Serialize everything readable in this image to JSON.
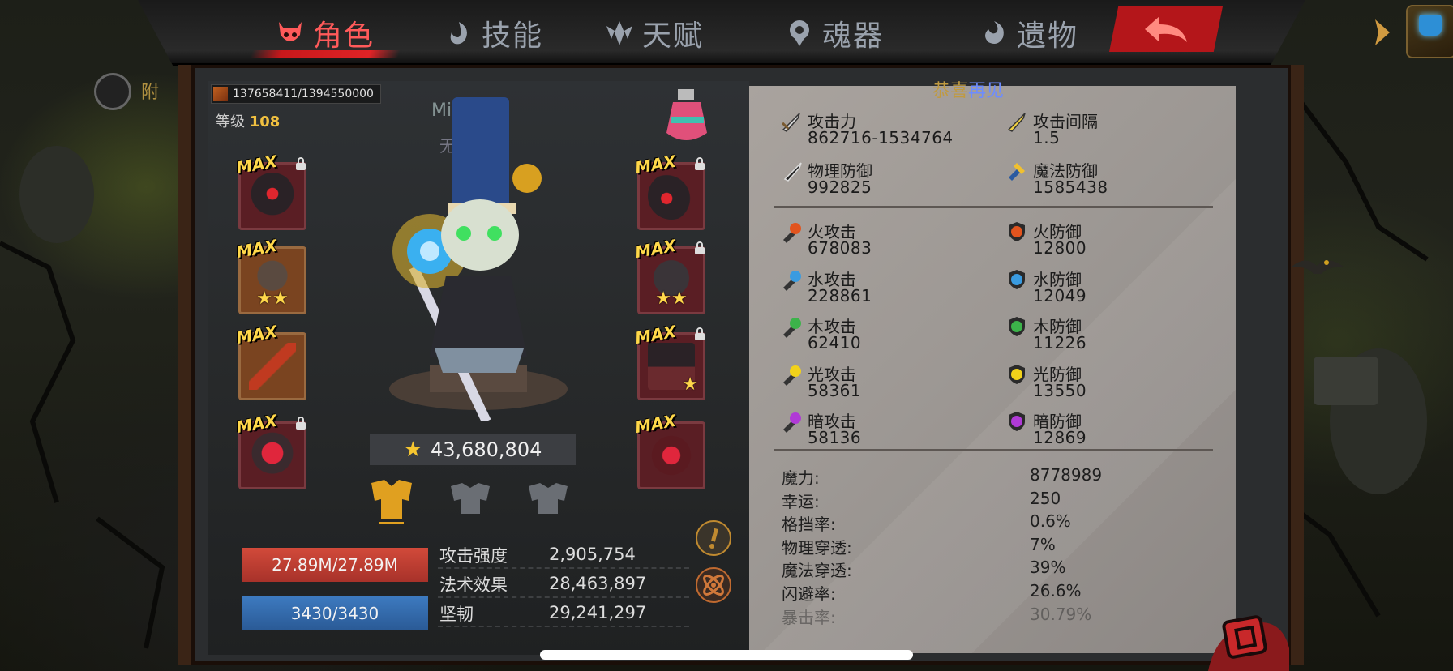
{
  "nav": {
    "tabs": [
      {
        "label": "角色",
        "active": true,
        "icon": "devil-face-icon"
      },
      {
        "label": "技能",
        "active": false,
        "icon": "flame-swirl-icon"
      },
      {
        "label": "天赋",
        "active": false,
        "icon": "crystal-wings-icon"
      },
      {
        "label": "魂器",
        "active": false,
        "icon": "soul-gem-icon"
      },
      {
        "label": "遗物",
        "active": false,
        "icon": "relic-swirl-icon"
      }
    ],
    "back_icon": "back-arrow-icon",
    "more_icon": "chevron-right-icon",
    "chest_icon": "treasure-chest-icon"
  },
  "side": {
    "label": "附"
  },
  "character": {
    "exp": "137658411/1394550000",
    "level_label": "等级",
    "level": "108",
    "name": "MissL..z",
    "title": "无称号",
    "power": "43,680,804",
    "hp": "27.89M/27.89M",
    "mp": "3430/3430",
    "combat": [
      {
        "label": "攻击强度",
        "value": "2,905,754"
      },
      {
        "label": "法术效果",
        "value": "28,463,897"
      },
      {
        "label": "坚韧",
        "value": "29,241,297"
      }
    ]
  },
  "equipment": {
    "max_label": "MAX",
    "left": [
      {
        "stars": 0
      },
      {
        "stars": 2
      },
      {
        "stars": 0
      },
      {
        "stars": 0
      }
    ],
    "right": [
      {
        "stars": 0
      },
      {
        "stars": 2
      },
      {
        "stars": 1
      },
      {
        "stars": 0
      }
    ]
  },
  "stats": {
    "banner_a": "恭喜",
    "banner_b": "再见",
    "primary": [
      {
        "label": "攻击力",
        "value": "862716-1534764",
        "icon": "sword-attack-icon"
      },
      {
        "label": "攻击间隔",
        "value": "1.5",
        "icon": "sword-speed-icon"
      },
      {
        "label": "物理防御",
        "value": "992825",
        "icon": "physical-defense-icon"
      },
      {
        "label": "魔法防御",
        "value": "1585438",
        "icon": "magic-defense-icon"
      }
    ],
    "elements": [
      {
        "label": "火攻击",
        "value": "678083",
        "icon": "fire-attack-icon",
        "color": "#e2541e"
      },
      {
        "label": "火防御",
        "value": "12800",
        "icon": "fire-defense-icon",
        "color": "#e2541e"
      },
      {
        "label": "水攻击",
        "value": "228861",
        "icon": "water-attack-icon",
        "color": "#3a9be0"
      },
      {
        "label": "水防御",
        "value": "12049",
        "icon": "water-defense-icon",
        "color": "#3a9be0"
      },
      {
        "label": "木攻击",
        "value": "62410",
        "icon": "wood-attack-icon",
        "color": "#3cb34a"
      },
      {
        "label": "木防御",
        "value": "11226",
        "icon": "wood-defense-icon",
        "color": "#3cb34a"
      },
      {
        "label": "光攻击",
        "value": "58361",
        "icon": "light-attack-icon",
        "color": "#f2d21a"
      },
      {
        "label": "光防御",
        "value": "13550",
        "icon": "light-defense-icon",
        "color": "#f2d21a"
      },
      {
        "label": "暗攻击",
        "value": "58136",
        "icon": "dark-attack-icon",
        "color": "#b03ad6"
      },
      {
        "label": "暗防御",
        "value": "12869",
        "icon": "dark-defense-icon",
        "color": "#b03ad6"
      }
    ],
    "misc": [
      {
        "label": "魔力:",
        "value": "8778989"
      },
      {
        "label": "幸运:",
        "value": "250"
      },
      {
        "label": "格挡率:",
        "value": "0.6%"
      },
      {
        "label": "物理穿透:",
        "value": "7%"
      },
      {
        "label": "魔法穿透:",
        "value": "39%"
      },
      {
        "label": "闪避率:",
        "value": "26.6%"
      },
      {
        "label": "暴击率:",
        "value": "30.79%"
      }
    ]
  }
}
